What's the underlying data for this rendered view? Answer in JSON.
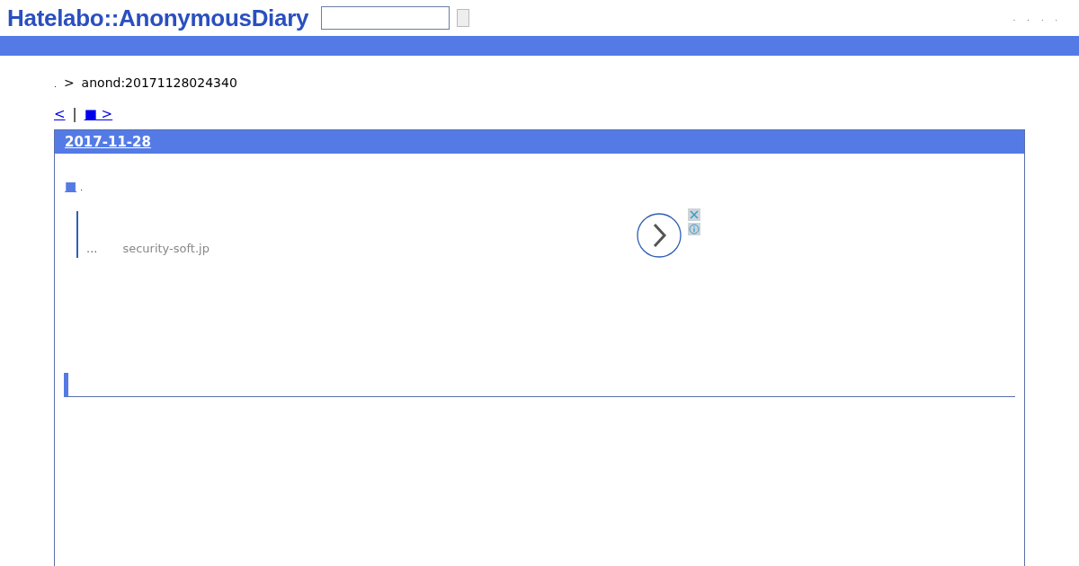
{
  "header": {
    "logo": "Hatelabo::AnonymousDiary",
    "menu": [
      ".",
      ".",
      ".",
      "."
    ]
  },
  "breadcrumb": {
    "home": ".",
    "separator": ">",
    "current": "anond:20171128024340"
  },
  "pager": {
    "prev": "<",
    "divider": "|",
    "next": "■ >"
  },
  "day": {
    "date": "2017-11-28",
    "section": {
      "mark": "■",
      "title": "."
    },
    "ad": {
      "text": "...",
      "domain": "security-soft.jp"
    }
  }
}
